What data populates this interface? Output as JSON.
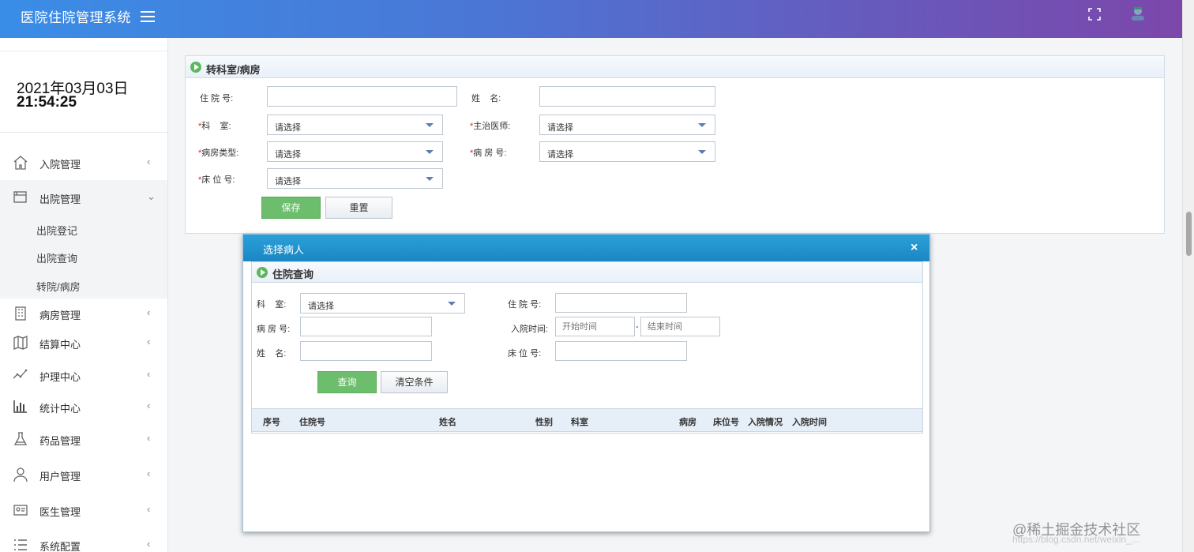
{
  "app": {
    "title": "医院住院管理系统"
  },
  "icons": {
    "menu": "hamburger-icon",
    "fullscreen": "fullscreen-icon",
    "avatar": "avatar-icon",
    "section": "play-circle-icon",
    "close": "close-icon",
    "chevron_left": "‹",
    "chevron_down": "⌄"
  },
  "colors": {
    "primary_start": "#3a8de6",
    "primary_end": "#7c47ab",
    "save_button": "#6cbd6c",
    "dialog_header": "#1a87c3",
    "required": "#e02020"
  },
  "clock": {
    "date": "2021年03月03日",
    "time": "21:54:25"
  },
  "sidebar": {
    "items": [
      {
        "label": "入院管理",
        "icon": "home-icon"
      },
      {
        "label": "出院管理",
        "icon": "window-icon"
      },
      {
        "label": "病房管理",
        "icon": "building-icon"
      },
      {
        "label": "结算中心",
        "icon": "map-icon"
      },
      {
        "label": "护理中心",
        "icon": "line-chart-icon"
      },
      {
        "label": "统计中心",
        "icon": "bar-chart-icon"
      },
      {
        "label": "药品管理",
        "icon": "flask-icon"
      },
      {
        "label": "用户管理",
        "icon": "user-icon"
      },
      {
        "label": "医生管理",
        "icon": "id-card-icon"
      },
      {
        "label": "系统配置",
        "icon": "list-icon"
      }
    ],
    "sub_items": [
      "出院登记",
      "出院查询",
      "转院/病房"
    ]
  },
  "transfer_form": {
    "title": "转科室/病房",
    "labels": {
      "inpatient_no": "住 院 号:",
      "name": "姓    名:",
      "department": "科    室:",
      "doctor": "主治医师:",
      "ward_type": "病房类型:",
      "ward_no": "病 房 号:",
      "bed_no": "床 位 号:"
    },
    "required_mark": "*",
    "select_placeholder": "请选择",
    "inpatient_no_value": "",
    "name_value": "",
    "save_label": "保存",
    "reset_label": "重置"
  },
  "dialog": {
    "title": "选择病人",
    "close_label": "×",
    "search": {
      "title": "住院查询",
      "labels": {
        "department": "科    室:",
        "inpatient_no": "住 院 号:",
        "ward_no": "病 房 号:",
        "admit_time": "入院时间:",
        "name": "姓    名:",
        "bed_no": "床 位 号:"
      },
      "select_placeholder": "请选择",
      "start_placeholder": "开始时间",
      "end_placeholder": "结束时间",
      "date_separator": "-",
      "query_label": "查询",
      "clear_label": "清空条件"
    },
    "columns": [
      "序号",
      "住院号",
      "姓名",
      "性别",
      "科室",
      "病房",
      "床位号",
      "入院情况",
      "入院时间"
    ]
  },
  "watermark": {
    "text": "@稀土掘金技术社区",
    "sub": "https://blog.csdn.net/weixin_..."
  }
}
